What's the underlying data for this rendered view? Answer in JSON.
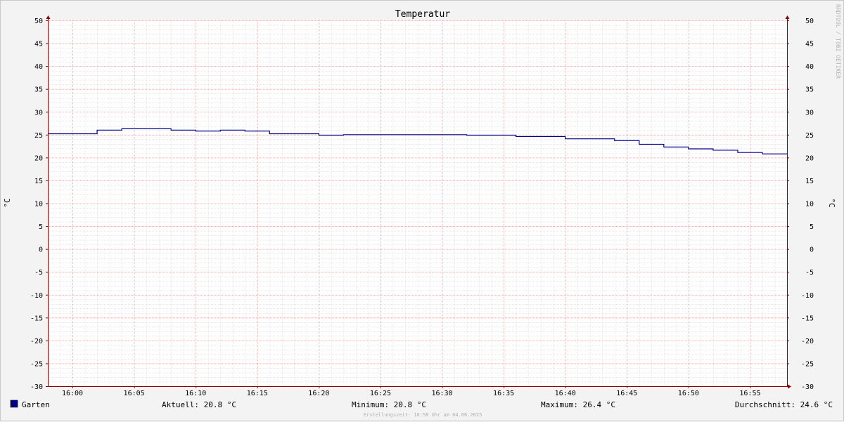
{
  "chart_data": {
    "type": "line",
    "title": "Temperatur",
    "ylabel_left": "°C",
    "ylabel_right": "°C",
    "ylim": [
      -30,
      50
    ],
    "y_ticks": [
      50,
      45,
      40,
      35,
      30,
      25,
      20,
      15,
      10,
      5,
      0,
      -5,
      -10,
      -15,
      -20,
      -25,
      -30
    ],
    "x_start": "15:58",
    "x_end": "16:58",
    "x_ticks": [
      "16:00",
      "16:05",
      "16:10",
      "16:15",
      "16:20",
      "16:25",
      "16:30",
      "16:35",
      "16:40",
      "16:45",
      "16:50",
      "16:55"
    ],
    "grid": true,
    "series": [
      {
        "name": "Garten",
        "color": "#00008b",
        "step": true,
        "points": [
          {
            "x": "15:58",
            "y": 25.2
          },
          {
            "x": "16:02",
            "y": 26.0
          },
          {
            "x": "16:04",
            "y": 26.3
          },
          {
            "x": "16:08",
            "y": 26.0
          },
          {
            "x": "16:10",
            "y": 25.8
          },
          {
            "x": "16:12",
            "y": 26.0
          },
          {
            "x": "16:14",
            "y": 25.8
          },
          {
            "x": "16:16",
            "y": 25.2
          },
          {
            "x": "16:20",
            "y": 24.9
          },
          {
            "x": "16:22",
            "y": 25.0
          },
          {
            "x": "16:32",
            "y": 24.9
          },
          {
            "x": "16:36",
            "y": 24.6
          },
          {
            "x": "16:40",
            "y": 24.1
          },
          {
            "x": "16:44",
            "y": 23.7
          },
          {
            "x": "16:46",
            "y": 22.9
          },
          {
            "x": "16:48",
            "y": 22.3
          },
          {
            "x": "16:50",
            "y": 21.9
          },
          {
            "x": "16:52",
            "y": 21.6
          },
          {
            "x": "16:54",
            "y": 21.1
          },
          {
            "x": "16:56",
            "y": 20.8
          },
          {
            "x": "16:58",
            "y": 20.8
          }
        ]
      }
    ]
  },
  "legend": {
    "series_name": "Garten",
    "swatch_color": "#00008b",
    "current": "Aktuell: 20.8 °C",
    "minimum": "Minimum: 20.8 °C",
    "maximum": "Maximum: 26.4 °C",
    "average": "Durchschnitt: 24.6 °C"
  },
  "footer": "Erstellungszeit: 16:58 Uhr am 04.06.2025",
  "watermark": "RRDTOOL / TOBI OETIKER",
  "colors": {
    "background": "#f3f3f3",
    "plot_background": "#ffffff",
    "major_grid": "#e8a0a0",
    "minor_grid": "#d8d8d8",
    "axis": "#8b0000"
  }
}
